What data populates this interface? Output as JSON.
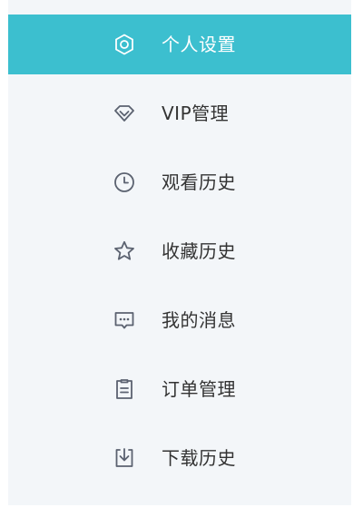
{
  "menu": {
    "items": [
      {
        "label": "个人设置",
        "icon": "settings-icon",
        "active": true
      },
      {
        "label": "VIP管理",
        "icon": "diamond-icon",
        "active": false
      },
      {
        "label": "观看历史",
        "icon": "clock-icon",
        "active": false
      },
      {
        "label": "收藏历史",
        "icon": "star-icon",
        "active": false
      },
      {
        "label": "我的消息",
        "icon": "message-icon",
        "active": false
      },
      {
        "label": "订单管理",
        "icon": "order-icon",
        "active": false
      },
      {
        "label": "下载历史",
        "icon": "download-icon",
        "active": false
      }
    ]
  },
  "colors": {
    "active_bg": "#3cbfcf",
    "panel_bg": "#f3f6f9",
    "text": "#333333",
    "icon": "#5b6270"
  }
}
